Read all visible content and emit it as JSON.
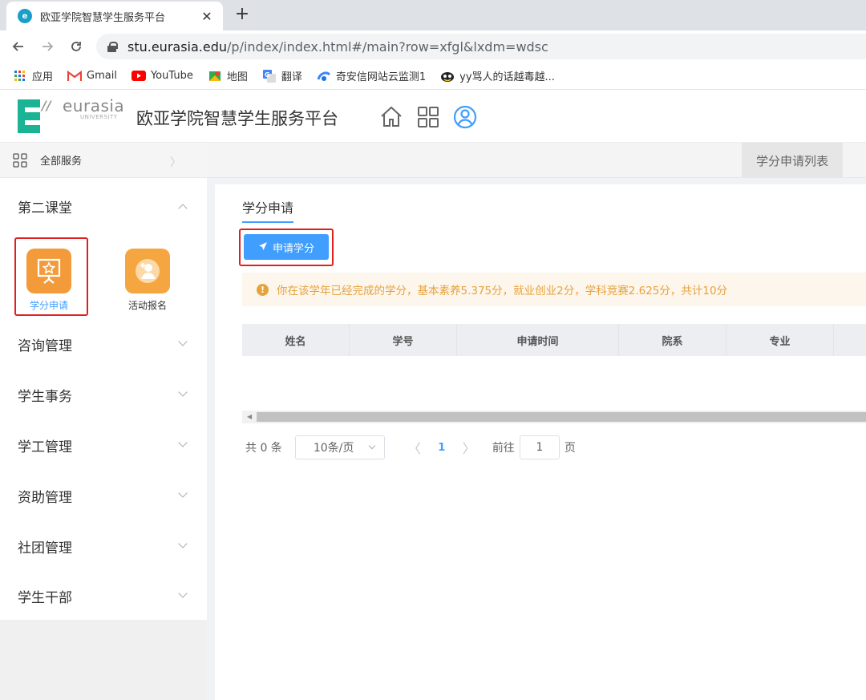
{
  "browser": {
    "tab_title": "欧亚学院智慧学生服务平台",
    "tab_close": "✕",
    "new_tab": "+",
    "url_host": "stu.eurasia.edu",
    "url_path": "/p/index/index.html#/main?row=xfgl&lxdm=wdsc",
    "bookmarks": [
      {
        "label": "应用",
        "icon": "apps-grid-icon"
      },
      {
        "label": "Gmail",
        "icon": "gmail-icon"
      },
      {
        "label": "YouTube",
        "icon": "youtube-icon"
      },
      {
        "label": "地图",
        "icon": "maps-icon"
      },
      {
        "label": "翻译",
        "icon": "translate-icon"
      },
      {
        "label": "奇安信网站云监测1",
        "icon": "monitor-icon"
      },
      {
        "label": "yy骂人的话越毒越...",
        "icon": "yy-icon"
      }
    ]
  },
  "header": {
    "logo_word": "eurasia",
    "logo_sub": "UNIVERSITY",
    "title": "欧亚学院智慧学生服务平台"
  },
  "sidebar": {
    "all_services": "全部服务",
    "groups": [
      {
        "label": "第二课堂",
        "expanded": true
      },
      {
        "label": "咨询管理",
        "expanded": false
      },
      {
        "label": "学生事务",
        "expanded": false
      },
      {
        "label": "学工管理",
        "expanded": false
      },
      {
        "label": "资助管理",
        "expanded": false
      },
      {
        "label": "社团管理",
        "expanded": false
      },
      {
        "label": "学生干部",
        "expanded": false
      }
    ],
    "apps": [
      {
        "label": "学分申请",
        "active": true
      },
      {
        "label": "活动报名",
        "active": false
      }
    ]
  },
  "main": {
    "page_tab": "学分申请列表",
    "subtab": "学分申请",
    "apply_button": "申请学分",
    "alert_text": "你在该学年已经完成的学分，基本素养5.375分，就业创业2分，学科竞赛2.625分，共计10分",
    "table": {
      "columns": [
        "姓名",
        "学号",
        "申请时间",
        "院系",
        "专业"
      ],
      "rows": []
    },
    "pagination": {
      "total": "共 0 条",
      "page_size": "10条/页",
      "current_page": "1",
      "goto_label": "前往",
      "goto_value": "1",
      "goto_suffix": "页"
    }
  },
  "colors": {
    "accent": "#409eff",
    "alert_text": "#e6a23c",
    "alert_bg": "#fdf6ec",
    "highlight_box": "#e02020",
    "app_orange": "#f39b3a",
    "logo_green": "#1ab394"
  }
}
